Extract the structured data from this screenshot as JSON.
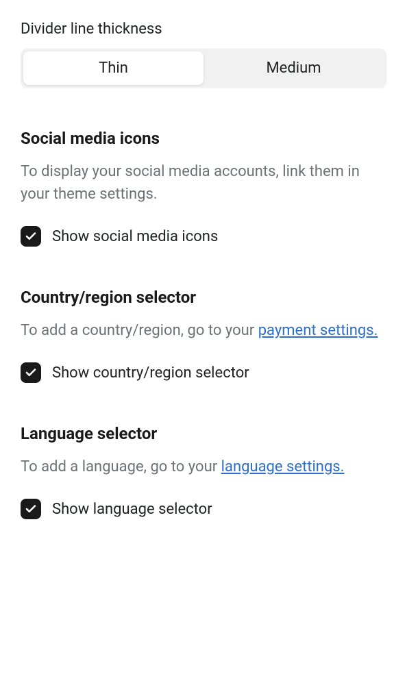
{
  "divider": {
    "label": "Divider line thickness",
    "options": {
      "thin": "Thin",
      "medium": "Medium"
    },
    "selected": "thin"
  },
  "social": {
    "heading": "Social media icons",
    "description": "To display your social media accounts, link them in your theme settings.",
    "checkbox_label": "Show social media icons",
    "checked": true
  },
  "country": {
    "heading": "Country/region selector",
    "description_prefix": "To add a country/region, go to your ",
    "link_text": "payment settings.",
    "checkbox_label": "Show country/region selector",
    "checked": true
  },
  "language": {
    "heading": "Language selector",
    "description_prefix": "To add a language, go to your ",
    "link_text": "language settings.",
    "checkbox_label": "Show language selector",
    "checked": true
  }
}
